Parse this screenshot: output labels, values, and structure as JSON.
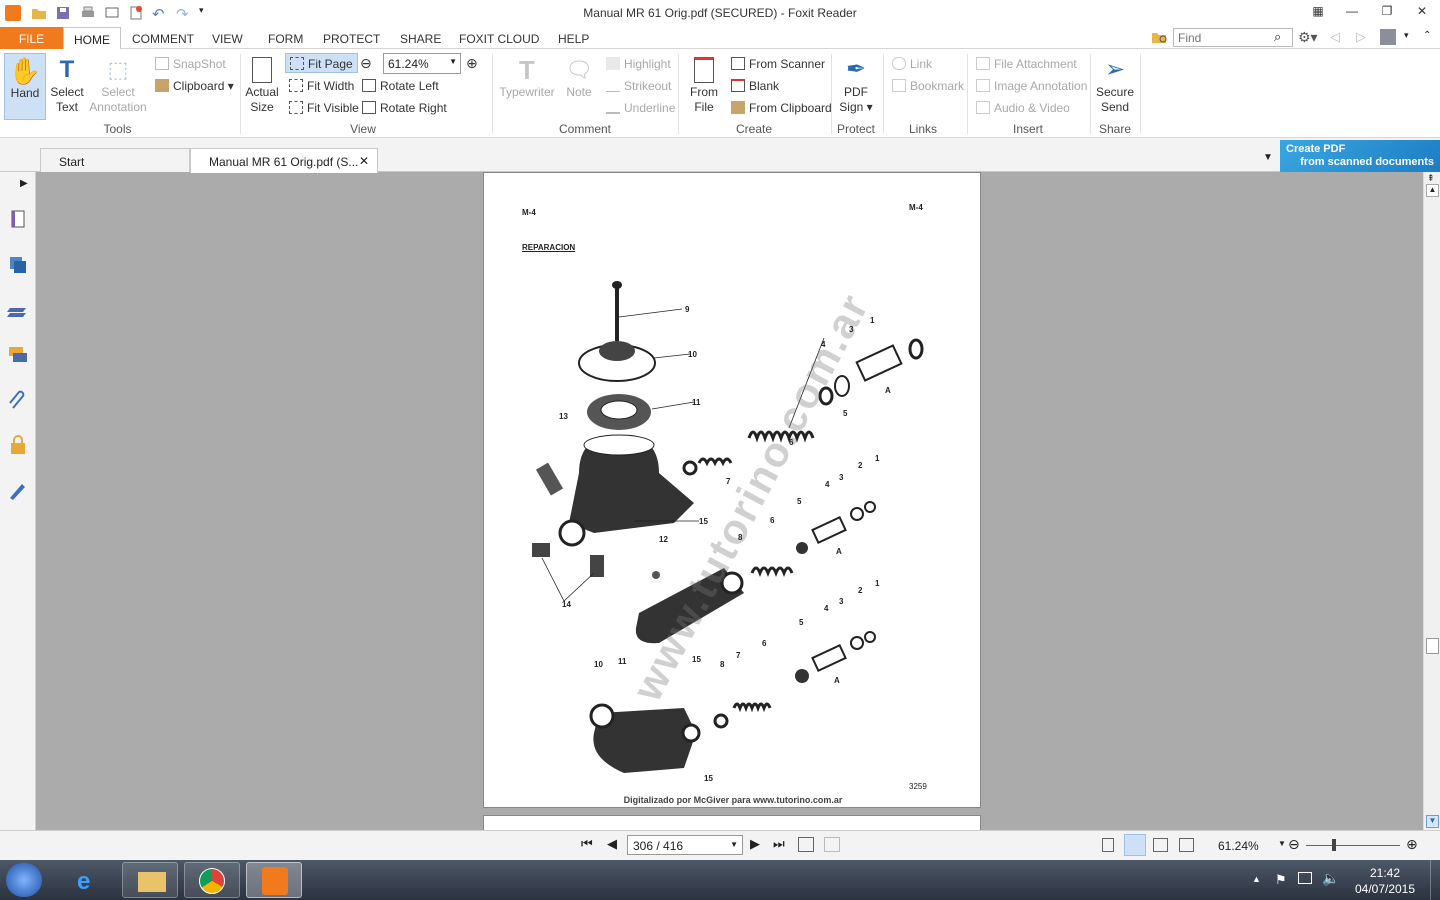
{
  "window": {
    "title": "Manual MR 61 Orig.pdf (SECURED) - Foxit Reader"
  },
  "menu": {
    "file": "FILE",
    "tabs": [
      "HOME",
      "COMMENT",
      "VIEW",
      "FORM",
      "PROTECT",
      "SHARE",
      "FOXIT CLOUD",
      "HELP"
    ]
  },
  "search": {
    "placeholder": "Find"
  },
  "ribbon": {
    "hand": "Hand",
    "select_text_1": "Select",
    "select_text_2": "Text",
    "select_annot_1": "Select",
    "select_annot_2": "Annotation",
    "snapshot": "SnapShot",
    "clipboard": "Clipboard",
    "tools_group": "Tools",
    "actual_1": "Actual",
    "actual_2": "Size",
    "fit_page": "Fit Page",
    "fit_width": "Fit Width",
    "fit_visible": "Fit Visible",
    "zoom": "61.24%",
    "rotate_left": "Rotate Left",
    "rotate_right": "Rotate Right",
    "view_group": "View",
    "typewriter": "Typewriter",
    "note": "Note",
    "highlight": "Highlight",
    "strikeout": "Strikeout",
    "underline": "Underline",
    "comment_group": "Comment",
    "from_file_1": "From",
    "from_file_2": "File",
    "from_scanner": "From Scanner",
    "blank": "Blank",
    "from_clipboard": "From Clipboard",
    "create_group": "Create",
    "pdf_sign_1": "PDF",
    "pdf_sign_2": "Sign",
    "protect_group": "Protect",
    "link": "Link",
    "bookmark": "Bookmark",
    "links_group": "Links",
    "file_attachment": "File Attachment",
    "image_annotation": "Image Annotation",
    "audio_video": "Audio & Video",
    "insert_group": "Insert",
    "secure_1": "Secure",
    "secure_2": "Send",
    "share_group": "Share"
  },
  "doc_tabs": {
    "start": "Start",
    "current": "Manual MR 61 Orig.pdf (S..."
  },
  "ad": {
    "line1": "Create PDF",
    "line2": "from scanned documents"
  },
  "pdf_page": {
    "header_left": "M-4",
    "header_right": "M-4",
    "heading": "REPARACION",
    "watermark": "www.tutorino.com.ar",
    "figure_number": "3259",
    "footer": "Digitalizado por McGiver para www.tutorino.com.ar",
    "callouts": [
      "9",
      "10",
      "11",
      "13",
      "15",
      "14",
      "1",
      "3",
      "4",
      "5",
      "6",
      "7",
      "A",
      "1",
      "2",
      "3",
      "4",
      "5",
      "6",
      "8",
      "12",
      "A",
      "15",
      "1",
      "2",
      "3",
      "4",
      "5",
      "6",
      "7",
      "8",
      "10",
      "11",
      "A",
      "15"
    ]
  },
  "status": {
    "page_field": "306 / 416",
    "zoom": "61.24%"
  },
  "taskbar": {
    "time": "21:42",
    "date": "04/07/2015"
  }
}
